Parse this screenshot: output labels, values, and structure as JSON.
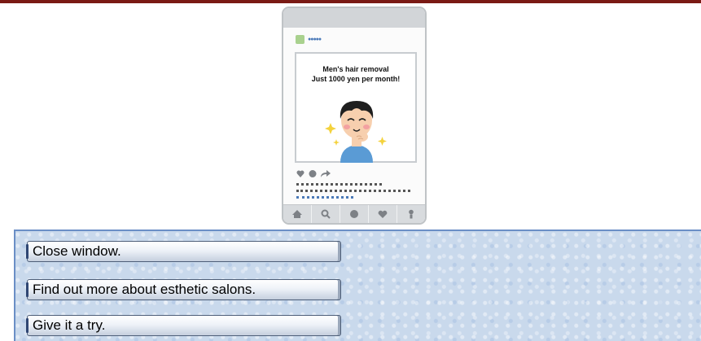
{
  "ad": {
    "line1": "Men's hair removal",
    "line2": "Just 1000 yen per month!",
    "account_handle": "●●●●●"
  },
  "choices": [
    {
      "label": "Close window."
    },
    {
      "label": "Find out more about esthetic salons."
    },
    {
      "label": "Give it a try."
    }
  ],
  "icons": {
    "post_actions": [
      "heart-icon",
      "comment-icon",
      "share-icon"
    ],
    "nav": [
      "home-icon",
      "search-icon",
      "camera-icon",
      "heart-icon",
      "profile-icon"
    ]
  },
  "colors": {
    "top_bar": "#7a1a14",
    "panel_bg": "#c9d9ec",
    "panel_border": "#6b8fc6"
  }
}
